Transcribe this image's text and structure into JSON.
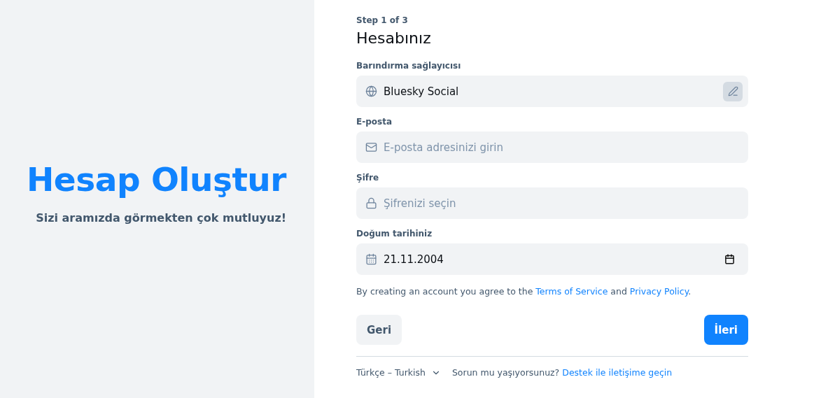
{
  "hero": {
    "title": "Hesap Oluştur",
    "subtitle": "Sizi aramızda görmekten çok mutluyuz!"
  },
  "step": "Step 1 of 3",
  "heading": "Hesabınız",
  "fields": [
    {
      "kind": "provider",
      "label": "Barındırma sağlayıcısı",
      "value": "Bluesky Social"
    },
    {
      "kind": "email",
      "label": "E-posta",
      "placeholder": "E-posta adresinizi girin"
    },
    {
      "kind": "password",
      "label": "Şifre",
      "placeholder": "Şifrenizi seçin"
    },
    {
      "kind": "date",
      "label": "Doğum tarihiniz",
      "value": "21.11.2004"
    }
  ],
  "terms": {
    "before": "By creating an account you agree to the",
    "link1": "Terms of Service",
    "middle": "and",
    "link2": "Privacy Policy",
    "end": "."
  },
  "buttons": {
    "back": "Geri",
    "next": "İleri"
  },
  "footer": {
    "language": "Türkçe – Turkish",
    "question": "Sorun mu yaşıyorsunuz?",
    "support": "Destek ile iletişime geçin"
  }
}
